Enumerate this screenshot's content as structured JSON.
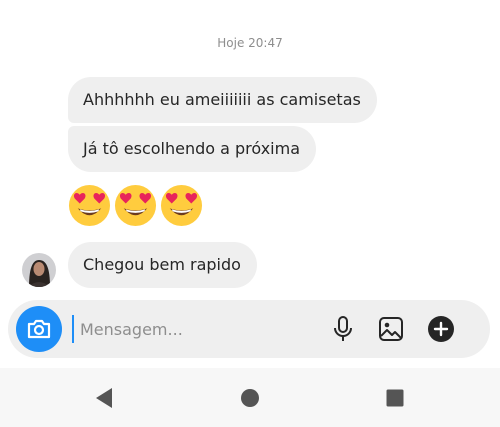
{
  "thread": {
    "timestamp": "Hoje 20:47",
    "messages": [
      {
        "text": "Ahhhhhh eu ameiiiiiii as camisetas"
      },
      {
        "text": "Já tô escolhendo a próxima"
      },
      {
        "emojis": [
          "😍",
          "😍",
          "😍"
        ],
        "emoji_icon": "heart-eyes-emoji"
      },
      {
        "text": "Chegou bem rapido",
        "avatar_icon": "user-avatar"
      }
    ]
  },
  "composer": {
    "placeholder": "Mensagem...",
    "icons": [
      "camera-icon",
      "microphone-icon",
      "image-gallery-icon",
      "add-circle-icon"
    ],
    "accent_color": "#1e8ef7"
  },
  "navigation_bar": {
    "icons": [
      "back-triangle-icon",
      "home-circle-icon",
      "recents-square-icon"
    ]
  }
}
